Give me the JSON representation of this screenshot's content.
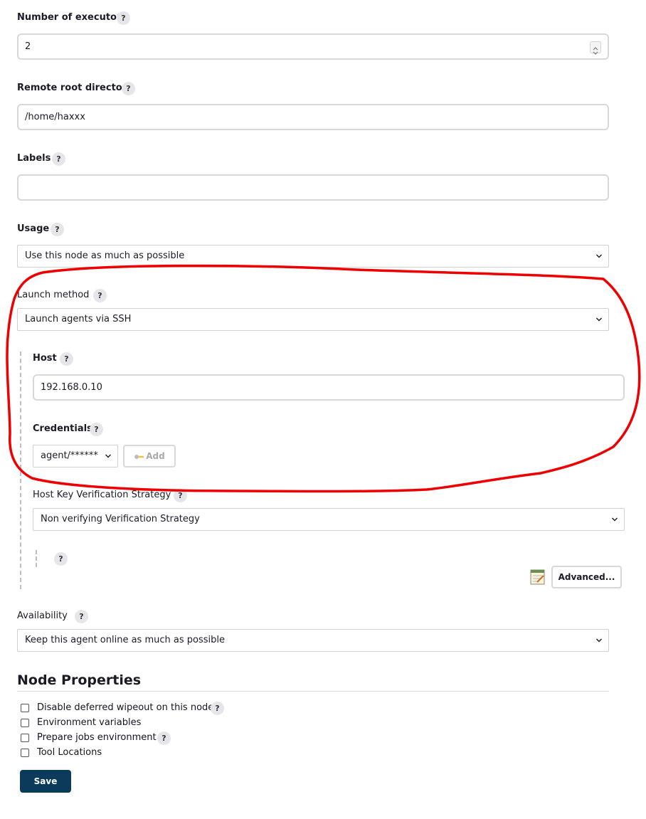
{
  "fields": {
    "executors": {
      "label": "Number of executors",
      "value": "2"
    },
    "remote_root": {
      "label": "Remote root directory",
      "value": "/home/haxxx"
    },
    "labels": {
      "label": "Labels",
      "value": ""
    },
    "usage": {
      "label": "Usage",
      "value": "Use this node as much as possible"
    },
    "launch_method": {
      "label": "Launch method",
      "value": "Launch agents via SSH"
    },
    "host": {
      "label": "Host",
      "value": "192.168.0.10"
    },
    "credentials": {
      "label": "Credentials",
      "value": "agent/******",
      "add_label": "Add"
    },
    "host_key": {
      "label": "Host Key Verification Strategy",
      "value": "Non verifying Verification Strategy"
    },
    "advanced_label": "Advanced...",
    "availability": {
      "label": "Availability",
      "value": "Keep this agent online as much as possible"
    }
  },
  "help_mark": "?",
  "node_properties": {
    "title": "Node Properties",
    "items": [
      {
        "label": "Disable deferred wipeout on this node",
        "checked": false,
        "has_help": true
      },
      {
        "label": "Environment variables",
        "checked": false,
        "has_help": false
      },
      {
        "label": "Prepare jobs environment",
        "checked": false,
        "has_help": true
      },
      {
        "label": "Tool Locations",
        "checked": false,
        "has_help": false
      }
    ]
  },
  "save_label": "Save",
  "colors": {
    "annotation": "#ee0000",
    "save_button": "#0b3a5b",
    "help_bg": "#e6e6ea"
  },
  "icons": [
    "help-icon",
    "chevron-down-icon",
    "spinner-icon",
    "key-icon",
    "notepad-icon",
    "checkbox-icon"
  ]
}
